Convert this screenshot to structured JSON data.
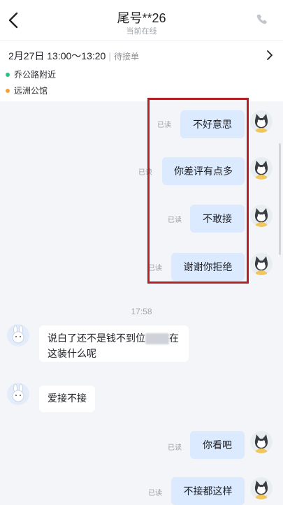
{
  "header": {
    "title": "尾号**26",
    "subtitle": "当前在线",
    "back_icon": "chevron-left-icon",
    "call_icon": "phone-icon"
  },
  "order": {
    "date": "2月27日 13:00～13:20",
    "separator": "|",
    "status": "待接单",
    "pickup": "乔公路附近",
    "dropoff": "远洲公馆",
    "pickup_color": "#2fbf80",
    "dropoff_color": "#f2a33a"
  },
  "messages": {
    "read_label": "已读",
    "m1": "不好意思",
    "m2": "你差评有点多",
    "m3": "不敢接",
    "m4": "谢谢你拒绝",
    "timestamp": "17:58",
    "in1_part1": "说白了还不是钱不到位",
    "in1_part2": "在这装什么呢",
    "in2": "爱接不接",
    "m5": "你看吧",
    "m6": "不接都这样"
  },
  "colors": {
    "outgoing_bubble": "#dbeafe",
    "incoming_bubble": "#ffffff",
    "highlight_box": "#b21f24",
    "background": "#f4f5f8"
  }
}
